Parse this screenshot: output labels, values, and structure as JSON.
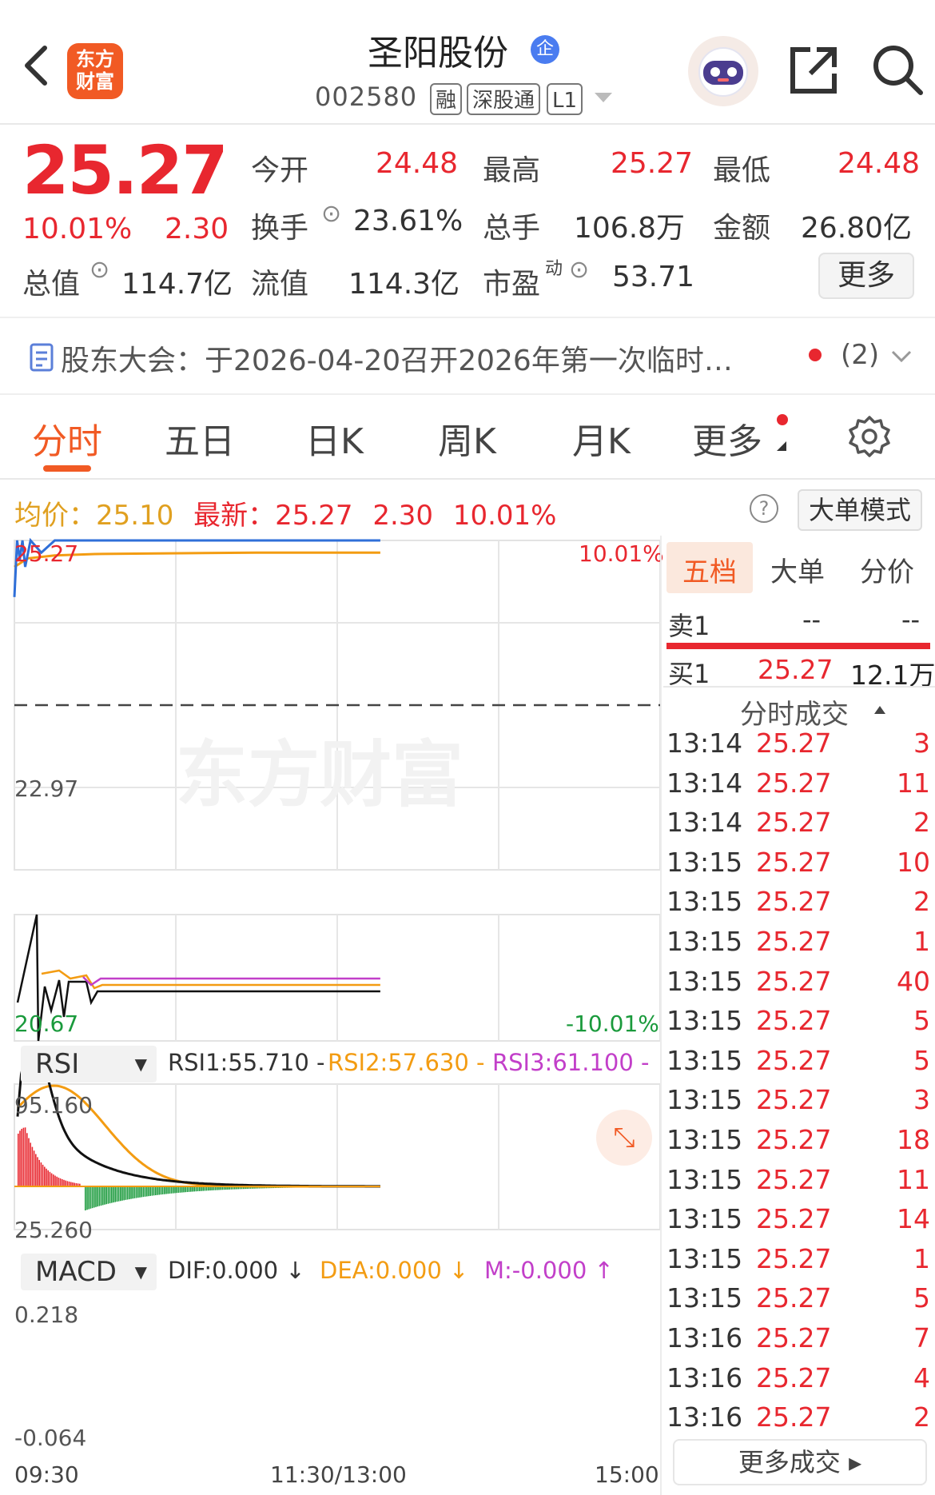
{
  "header": {
    "stock_name": "圣阳股份",
    "enterprise_badge": "企",
    "stock_code": "002580",
    "tags": [
      "融",
      "深股通",
      "L1"
    ],
    "logo_text": [
      "东方",
      "财富"
    ]
  },
  "quote": {
    "price": "25.27",
    "change_pct": "10.01%",
    "change": "2.30",
    "open_label": "今开",
    "open": "24.48",
    "high_label": "最高",
    "high": "25.27",
    "low_label": "最低",
    "low": "24.48",
    "turnover_label": "换手",
    "turnover": "23.61%",
    "volume_label": "总手",
    "volume": "106.8万",
    "amount_label": "金额",
    "amount": "26.80亿",
    "mktcap_label": "总值",
    "mktcap": "114.7亿",
    "float_label": "流值",
    "float_cap": "114.3亿",
    "pe_label": "市盈",
    "pe_sup": "动",
    "pe": "53.71",
    "more_button": "更多"
  },
  "notice": {
    "text": "股东大会：于2026-04-20召开2026年第一次临时…",
    "count": "(2)"
  },
  "tabs": [
    "分时",
    "五日",
    "日K",
    "周K",
    "月K",
    "更多"
  ],
  "info_bar": {
    "avg_label": "均价：",
    "avg": "25.10",
    "latest_label": "最新：",
    "latest": "25.27",
    "change": "2.30",
    "change_pct": "10.01%",
    "mode_button": "大单模式"
  },
  "chart_data": {
    "type": "line",
    "y_left_ticks": [
      "25.27",
      "22.97",
      "20.67"
    ],
    "y_right_ticks": [
      "10.01%",
      "-10.01%"
    ],
    "x_ticks": [
      "09:30",
      "11:30/13:00",
      "15:00"
    ],
    "ylim": [
      20.67,
      25.27
    ],
    "prev_close": 22.97,
    "series": [
      {
        "x": [
          "09:30",
          "09:31",
          "09:32",
          "09:33",
          "09:34",
          "09:36",
          "09:40",
          "09:45",
          "09:50",
          "10:00",
          "10:30",
          "11:00",
          "11:30",
          "13:00",
          "13:16"
        ],
        "values": [
          24.48,
          25.27,
          25.0,
          25.27,
          24.9,
          25.27,
          25.1,
          25.27,
          25.27,
          25.27,
          25.27,
          25.27,
          25.27,
          25.27,
          25.27
        ]
      },
      {
        "x": [
          "09:30",
          "09:35",
          "09:45",
          "10:00",
          "11:00",
          "13:16"
        ],
        "values": [
          24.9,
          25.02,
          25.06,
          25.08,
          25.1,
          25.1
        ]
      }
    ],
    "colors": {
      "price": "#2f6fd8",
      "avg": "#f39c12",
      "dash": "#444444"
    }
  },
  "rsi": {
    "name": "RSI",
    "rsi1": "RSI1:55.710 -",
    "rsi2": "RSI2:57.630 -",
    "rsi3": "RSI3:61.100 -",
    "top": "95.160",
    "bottom": "25.260"
  },
  "macd": {
    "name": "MACD",
    "dif": "DIF:0.000 ↓",
    "dea": "DEA:0.000 ↓",
    "m": "M:-0.000 ↑",
    "top": "0.218",
    "bottom": "-0.064"
  },
  "order_book": {
    "tabs": [
      "五档",
      "大单",
      "分价"
    ],
    "sell1_label": "卖1",
    "sell1_price": "--",
    "sell1_vol": "--",
    "buy1_label": "买1",
    "buy1_price": "25.27",
    "buy1_vol": "12.1万"
  },
  "trades": {
    "title": "分时成交",
    "rows": [
      {
        "t": "13:14",
        "p": "25.27",
        "v": "3"
      },
      {
        "t": "13:14",
        "p": "25.27",
        "v": "11"
      },
      {
        "t": "13:14",
        "p": "25.27",
        "v": "2"
      },
      {
        "t": "13:15",
        "p": "25.27",
        "v": "10"
      },
      {
        "t": "13:15",
        "p": "25.27",
        "v": "2"
      },
      {
        "t": "13:15",
        "p": "25.27",
        "v": "1"
      },
      {
        "t": "13:15",
        "p": "25.27",
        "v": "40"
      },
      {
        "t": "13:15",
        "p": "25.27",
        "v": "5"
      },
      {
        "t": "13:15",
        "p": "25.27",
        "v": "5"
      },
      {
        "t": "13:15",
        "p": "25.27",
        "v": "3"
      },
      {
        "t": "13:15",
        "p": "25.27",
        "v": "18"
      },
      {
        "t": "13:15",
        "p": "25.27",
        "v": "11"
      },
      {
        "t": "13:15",
        "p": "25.27",
        "v": "14"
      },
      {
        "t": "13:15",
        "p": "25.27",
        "v": "1"
      },
      {
        "t": "13:15",
        "p": "25.27",
        "v": "5"
      },
      {
        "t": "13:16",
        "p": "25.27",
        "v": "7"
      },
      {
        "t": "13:16",
        "p": "25.27",
        "v": "4"
      },
      {
        "t": "13:16",
        "p": "25.27",
        "v": "2"
      }
    ],
    "more_button": "更多成交"
  }
}
